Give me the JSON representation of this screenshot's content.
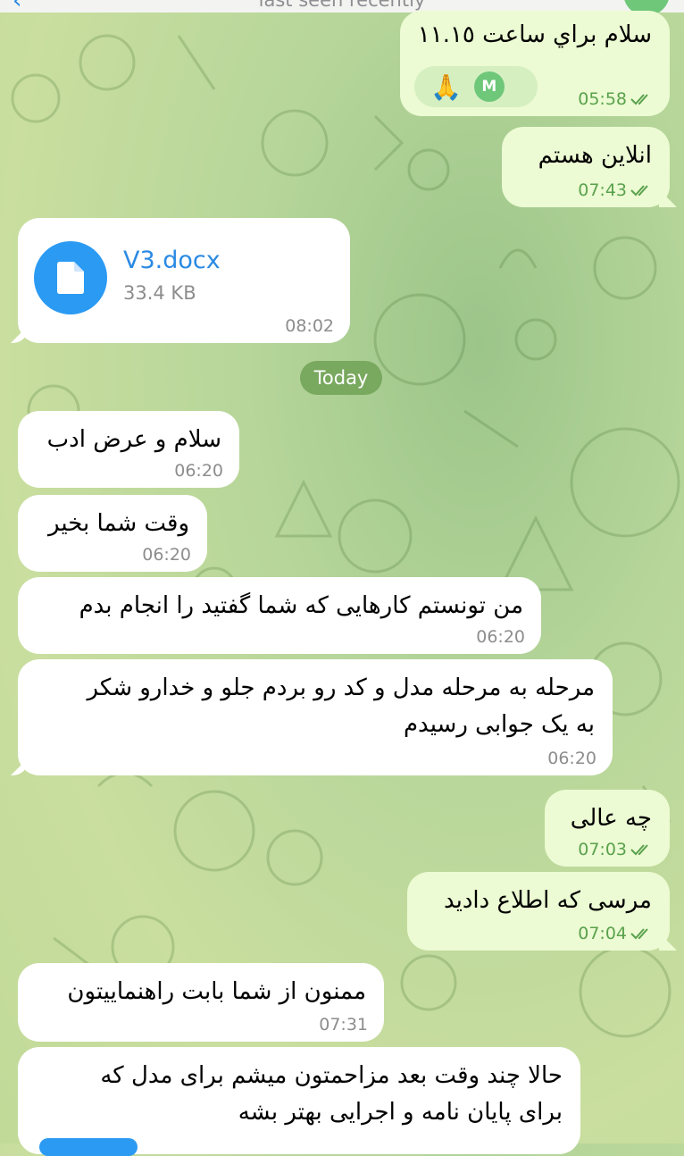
{
  "header": {
    "status": "last seen recently",
    "back_icon": "chevron-left-icon",
    "avatar_color": "#6fc77a"
  },
  "date_separator": "Today",
  "messages": [
    {
      "id": "m1",
      "direction": "out",
      "lines": [
        "سلام براي ساعت ١١.١٥"
      ],
      "time": "05:58",
      "read": true,
      "reactions": {
        "emoji": "🙏",
        "avatar_initial": "M"
      }
    },
    {
      "id": "m2",
      "direction": "out",
      "lines": [
        "انلاین هستم"
      ],
      "time": "07:43",
      "read": true
    },
    {
      "id": "m3",
      "direction": "in",
      "file": {
        "name": "V3.docx",
        "size": "33.4 KB",
        "icon": "document-icon"
      },
      "time": "08:02"
    },
    {
      "id": "m4",
      "direction": "in",
      "lines": [
        "سلام و عرض ادب"
      ],
      "time": "06:20"
    },
    {
      "id": "m5",
      "direction": "in",
      "lines": [
        "وقت شما بخیر"
      ],
      "time": "06:20"
    },
    {
      "id": "m6",
      "direction": "in",
      "lines": [
        "من تونستم کارهایی که شما گفتید را انجام بدم"
      ],
      "time": "06:20"
    },
    {
      "id": "m7",
      "direction": "in",
      "lines": [
        "مرحله به مرحله مدل و کد رو بردم جلو و خدارو شکر",
        "به یک جوابی رسیدم"
      ],
      "time": "06:20"
    },
    {
      "id": "m8",
      "direction": "out",
      "lines": [
        "چه عالی"
      ],
      "time": "07:03",
      "read": true
    },
    {
      "id": "m9",
      "direction": "out",
      "lines": [
        "مرسی که اطلاع دادید"
      ],
      "time": "07:04",
      "read": true
    },
    {
      "id": "m10",
      "direction": "in",
      "lines": [
        "ممنون از شما بابت راهنماییتون"
      ],
      "time": "07:31"
    },
    {
      "id": "m11",
      "direction": "in",
      "lines": [
        "حالا چند وقت بعد مزاحمتون میشم برای مدل که",
        "برای پایان نامه و اجرایی بهتر بشه"
      ],
      "time": ""
    }
  ],
  "colors": {
    "incoming": "#ffffff",
    "outgoing": "#ecfbd3",
    "accent": "#2a8ae3",
    "check": "#5aa14d"
  }
}
